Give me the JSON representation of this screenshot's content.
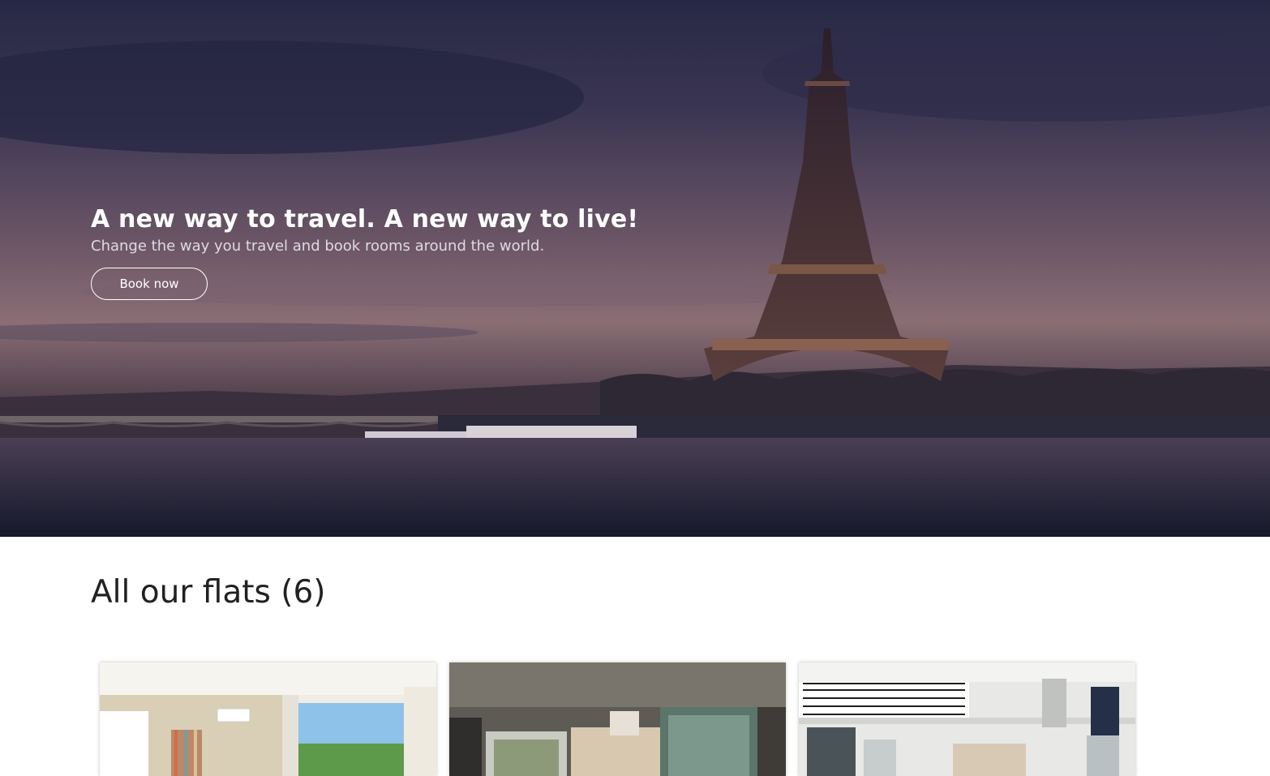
{
  "hero": {
    "title": "A new way to travel. A new way to live!",
    "subtitle": "Change the way you travel and book rooms around the world.",
    "cta_label": "Book now"
  },
  "flats": {
    "heading": "All our flats (6)",
    "cards": [
      {
        "image": "bright-bedroom-photo"
      },
      {
        "image": "modern-loft-bathroom-photo"
      },
      {
        "image": "mezzanine-bedroom-photo"
      }
    ]
  }
}
